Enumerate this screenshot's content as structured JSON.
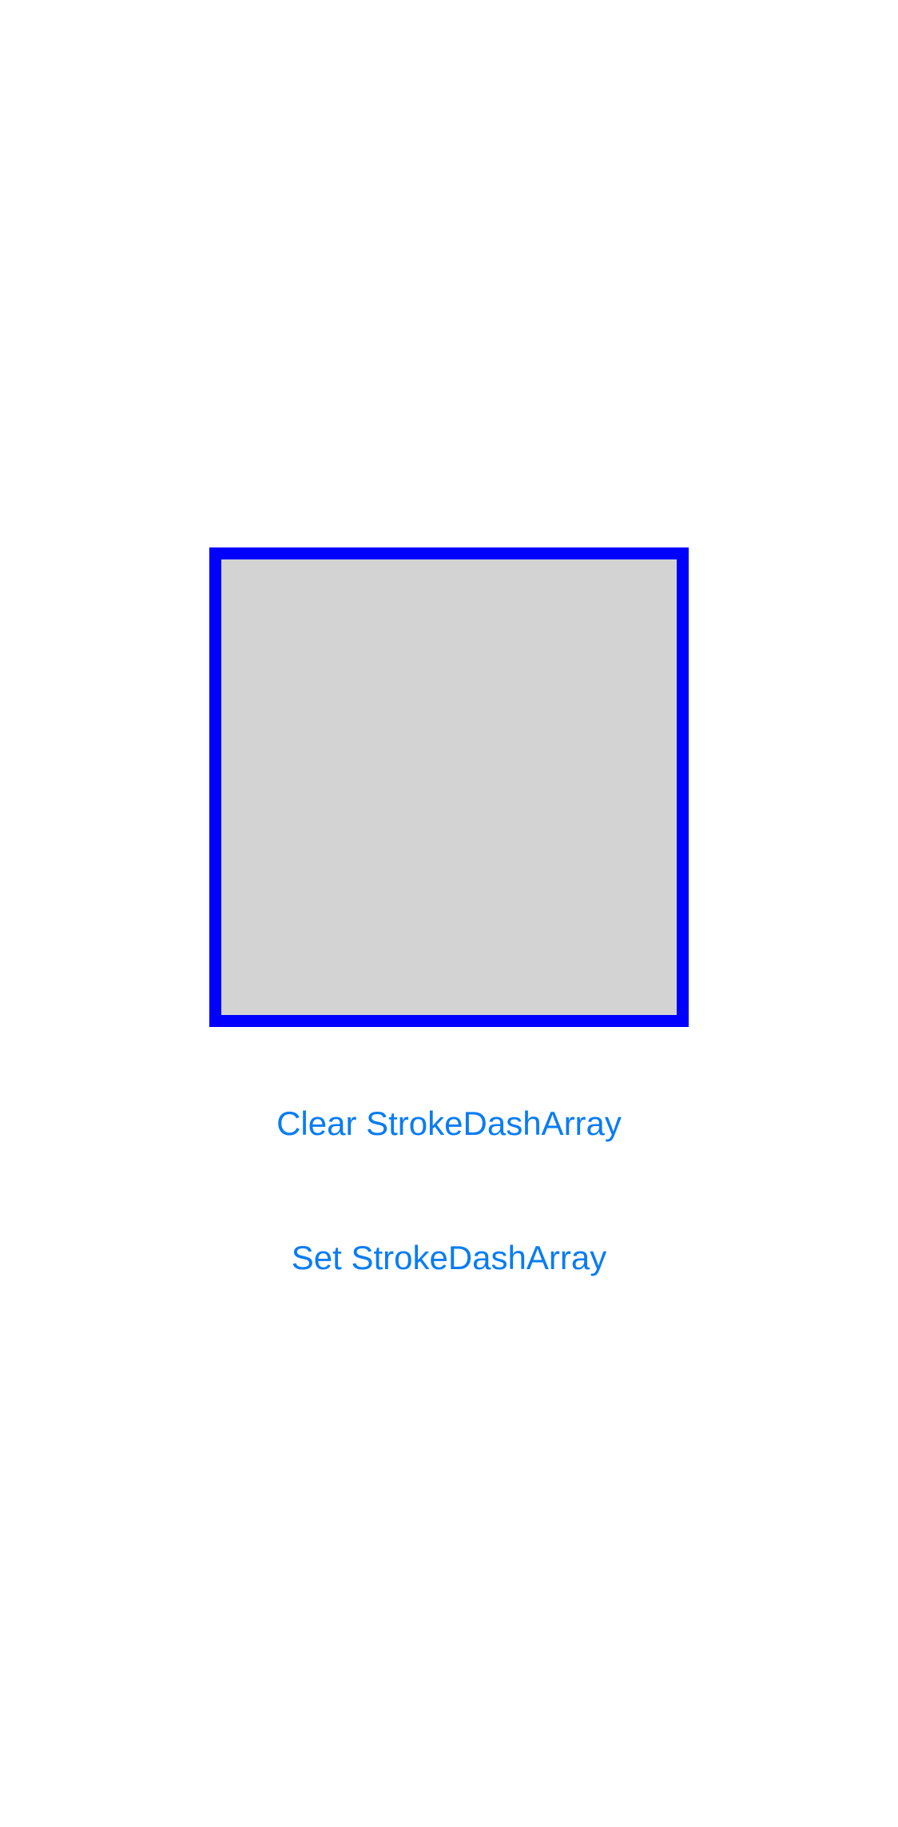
{
  "shape": {
    "fill_color": "#d3d3d3",
    "stroke_color": "#0000ff",
    "stroke_dash_array": "none"
  },
  "buttons": {
    "clear_label": "Clear StrokeDashArray",
    "set_label": "Set StrokeDashArray",
    "color": "#0a7cf2"
  }
}
